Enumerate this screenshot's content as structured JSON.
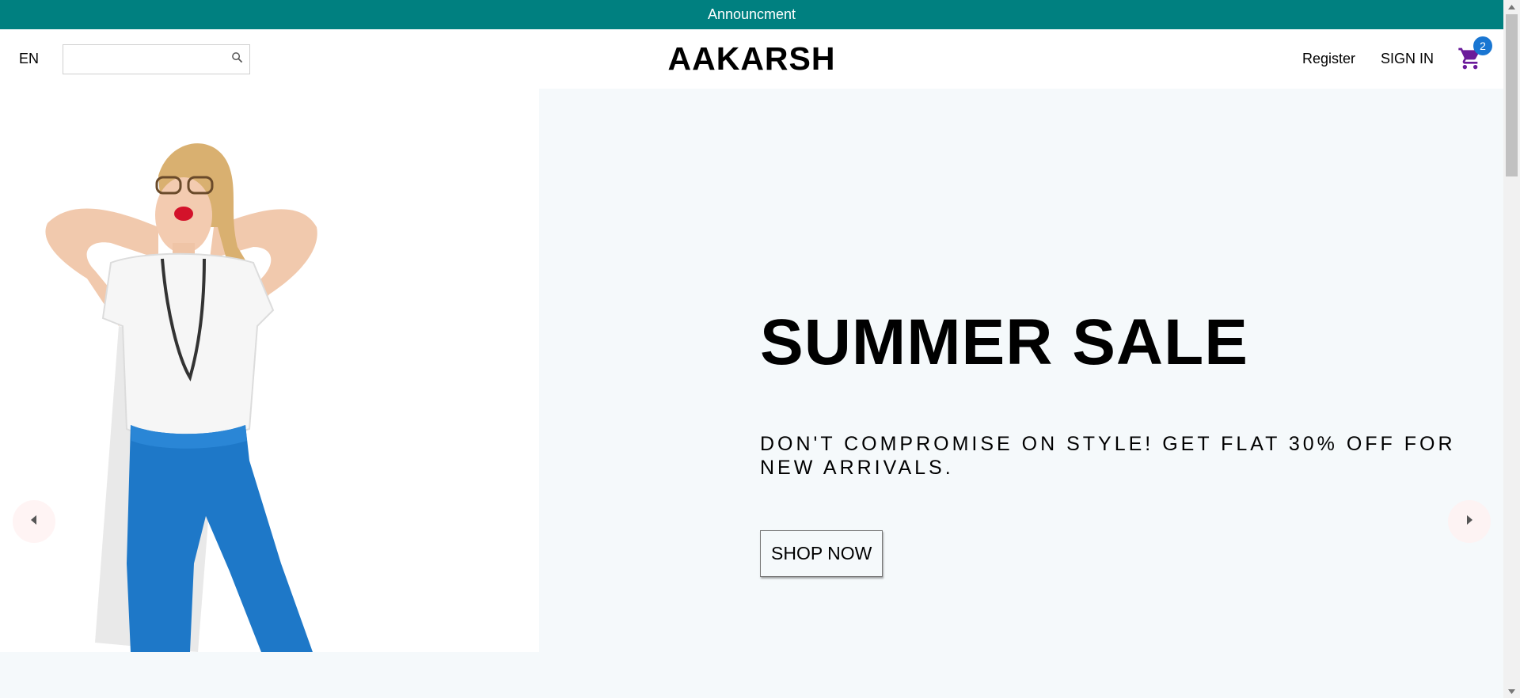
{
  "announcement": {
    "text": "Announcment"
  },
  "navbar": {
    "language": "EN",
    "search": {
      "placeholder": "",
      "value": "",
      "icon": "search-icon"
    },
    "logo": "AAKARSH",
    "register_label": "Register",
    "signin_label": "SIGN IN",
    "cart": {
      "icon": "shopping-cart-icon",
      "count": "2"
    }
  },
  "slider": {
    "slide": {
      "title": "SUMMER SALE",
      "description": "DON'T COMPROMISE ON STYLE! GET FLAT 30% OFF FOR NEW ARRIVALS.",
      "button_label": "SHOP NOW",
      "image": "model-photo"
    },
    "prev_icon": "chevron-left-icon",
    "next_icon": "chevron-right-icon",
    "background_color": "#f5f9fb"
  },
  "colors": {
    "announcement_bg": "#008080",
    "badge": "#1976d2",
    "cart_icon": "#6a1b9a"
  }
}
